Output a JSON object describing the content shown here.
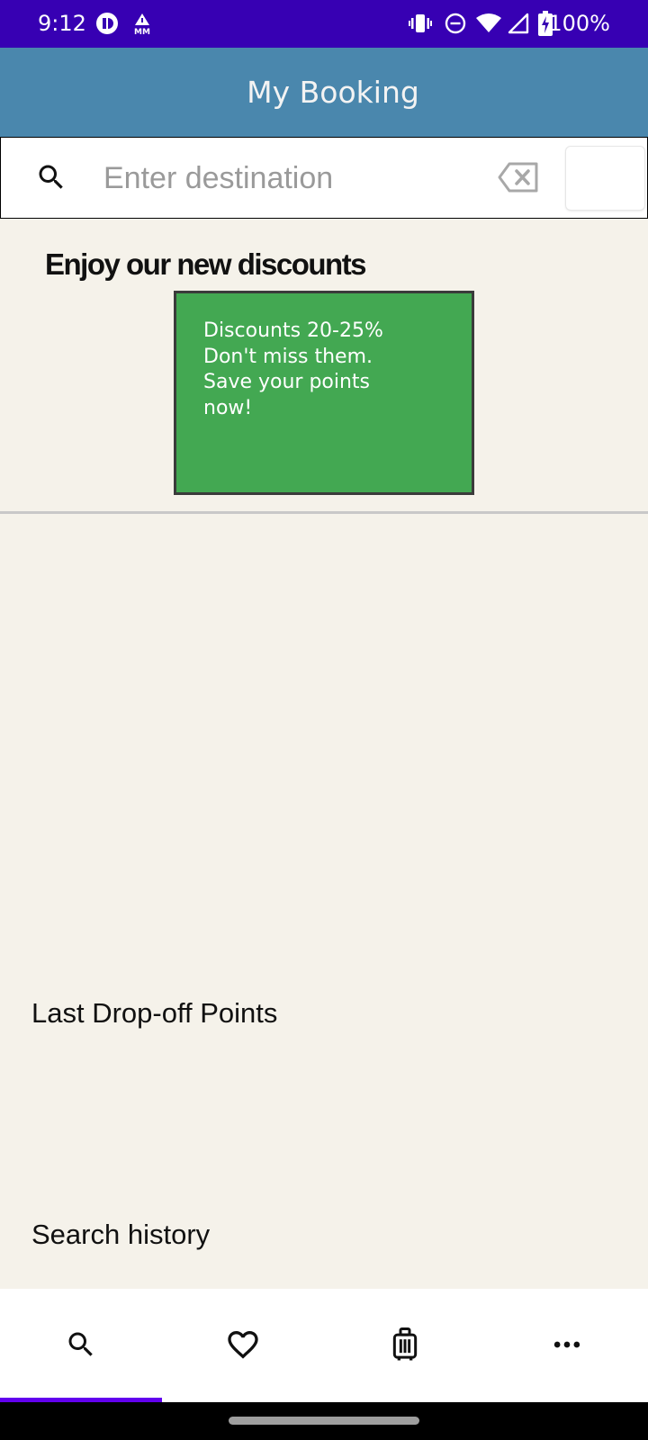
{
  "status_bar": {
    "time": "9:12",
    "battery": "100%",
    "icons": [
      "app-notification-icon",
      "alert-mm-icon",
      "vibrate-icon",
      "do-not-disturb-icon",
      "wifi-icon",
      "cell-signal-icon",
      "battery-charging-icon"
    ]
  },
  "app_bar": {
    "title": "My Booking",
    "color": "#4a87ad"
  },
  "search": {
    "placeholder": "Enter destination",
    "value": ""
  },
  "promo": {
    "heading": "Enjoy our new discounts",
    "card_lines": [
      "Discounts 20-25%",
      "Don't miss them.",
      "Save your points",
      "now!"
    ],
    "card_color": "#43a852"
  },
  "sections": {
    "dropoff_title": "Last Drop-off Points",
    "history_title": "Search history"
  },
  "bottom_nav": {
    "items": [
      {
        "icon": "search-icon",
        "selected": true
      },
      {
        "icon": "heart-icon",
        "selected": false
      },
      {
        "icon": "luggage-icon",
        "selected": false
      },
      {
        "icon": "more-icon",
        "selected": false
      }
    ],
    "indicator_color": "#6200ee"
  }
}
